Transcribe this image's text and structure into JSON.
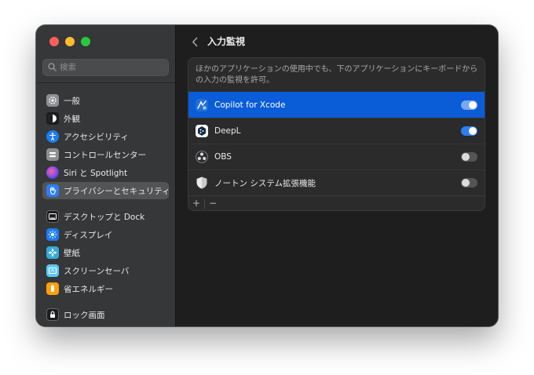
{
  "sidebar": {
    "search_placeholder": "検索",
    "items": [
      {
        "label": "一般",
        "icon": "gear-icon",
        "color": "#8e8e93"
      },
      {
        "label": "外観",
        "icon": "appearance-icon",
        "color": "#1c1c1e"
      },
      {
        "label": "アクセシビリティ",
        "icon": "accessibility-icon",
        "color": "#1a7cf5"
      },
      {
        "label": "コントロールセンター",
        "icon": "control-center-icon",
        "color": "#8e8e93"
      },
      {
        "label": "Siri と Spotlight",
        "icon": "siri-icon",
        "color": "#b04bd9"
      },
      {
        "label": "プライバシーとセキュリティ",
        "icon": "hand-icon",
        "color": "#2f7df6",
        "active": true
      },
      {
        "label": "デスクトップと Dock",
        "icon": "desktop-dock-icon",
        "color": "#1c1c1e"
      },
      {
        "label": "ディスプレイ",
        "icon": "display-icon",
        "color": "#1a7cf5"
      },
      {
        "label": "壁紙",
        "icon": "wallpaper-icon",
        "color": "#34aadc"
      },
      {
        "label": "スクリーンセーバ",
        "icon": "screensaver-icon",
        "color": "#5ac8fa"
      },
      {
        "label": "省エネルギー",
        "icon": "battery-icon",
        "color": "#ff9f0a"
      },
      {
        "label": "ロック画面",
        "icon": "lock-icon",
        "color": "#1c1c1e"
      }
    ]
  },
  "main": {
    "title": "入力監視",
    "description": "ほかのアプリケーションの使用中でも、下のアプリケーションにキーボードからの入力の監視を許可。",
    "apps": [
      {
        "name": "Copilot for Xcode",
        "icon": "copilot-icon",
        "enabled": true,
        "selected": true
      },
      {
        "name": "DeepL",
        "icon": "deepl-icon",
        "enabled": true,
        "selected": false
      },
      {
        "name": "OBS",
        "icon": "obs-icon",
        "enabled": false,
        "selected": false
      },
      {
        "name": "ノートン システム拡張機能",
        "icon": "norton-shield-icon",
        "enabled": false,
        "selected": false
      }
    ],
    "add_label": "+",
    "remove_label": "−"
  },
  "colors": {
    "accent": "#0a5cd7",
    "toggle_on": "#2f7df6",
    "sidebar_bg": "#363738",
    "main_bg": "#1e1e1e"
  }
}
